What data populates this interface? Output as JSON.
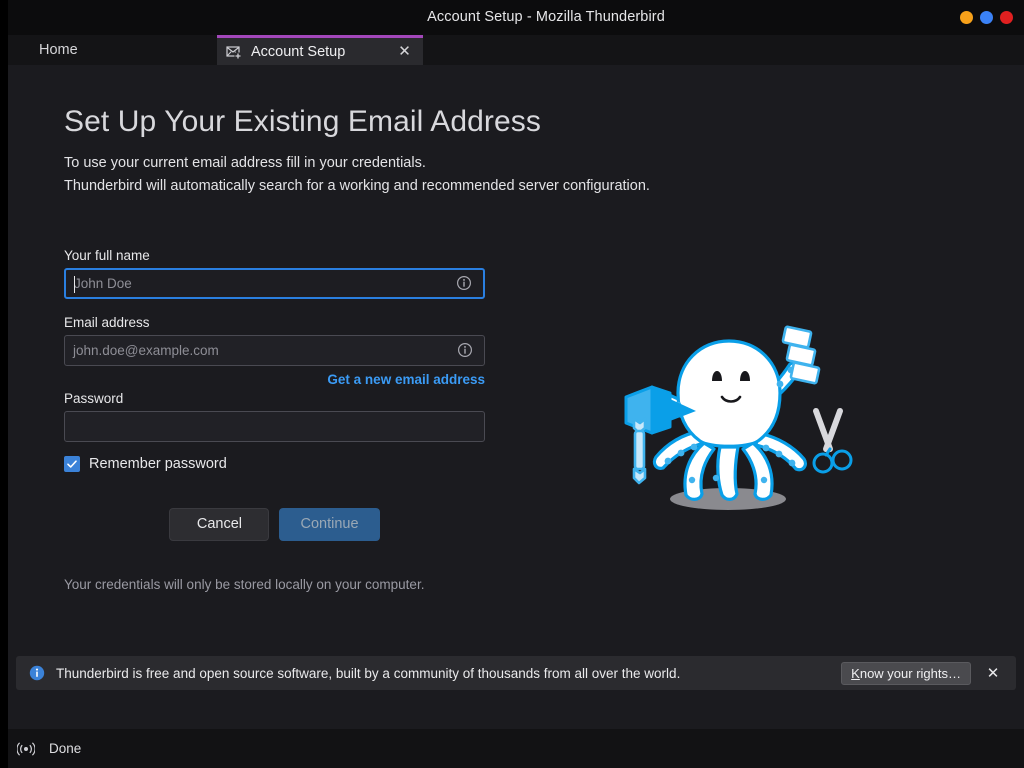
{
  "window": {
    "title": "Account Setup - Mozilla Thunderbird",
    "controls": [
      {
        "name": "minimize",
        "color": "#f7a11a"
      },
      {
        "name": "maximize",
        "color": "#3b82f6"
      },
      {
        "name": "close",
        "color": "#e02020"
      }
    ]
  },
  "tabs": [
    {
      "label": "Home",
      "icon": "",
      "active": false,
      "closable": false
    },
    {
      "label": "Account Setup",
      "icon": "envelope-plus-icon",
      "active": true,
      "closable": true,
      "close_glyph": "✕",
      "accent": "#a347ba"
    }
  ],
  "page": {
    "title": "Set Up Your Existing Email Address",
    "description_line1": "To use your current email address fill in your credentials.",
    "description_line2": "Thunderbird will automatically search for a working and recommended server configuration.",
    "footnote": "Your credentials will only be stored locally on your computer."
  },
  "form": {
    "fullname": {
      "label": "Your full name",
      "value": "",
      "placeholder": "John Doe",
      "focused": true,
      "info_icon": "info-circle-icon"
    },
    "email": {
      "label": "Email address",
      "value": "",
      "placeholder": "john.doe@example.com",
      "focused": false,
      "info_icon": "info-circle-icon"
    },
    "new_email_link": "Get a new email address",
    "password": {
      "label": "Password",
      "value": "",
      "placeholder": ""
    },
    "remember": {
      "label": "Remember password",
      "checked": true,
      "check_glyph": "✓"
    },
    "cancel_label": "Cancel",
    "continue_label": "Continue",
    "continue_disabled": true
  },
  "notification": {
    "icon": "info-circle-filled-icon",
    "message": "Thunderbird is free and open source software, built by a community of thousands from all over the world.",
    "button_accesskey": "K",
    "button_label_rest": "now your rights…",
    "close_glyph": "✕"
  },
  "statusbar": {
    "icon": "broadcast-icon",
    "text": "Done"
  },
  "colors": {
    "background": "#1b1b1f",
    "titlebar": "#0c0c0d",
    "accent_purple": "#a347ba",
    "link_blue": "#3b9bf5",
    "focus_blue": "#2a7fe0",
    "continue_blue": "#2c5d8f",
    "mascot_blue": "#0a9fe8"
  }
}
